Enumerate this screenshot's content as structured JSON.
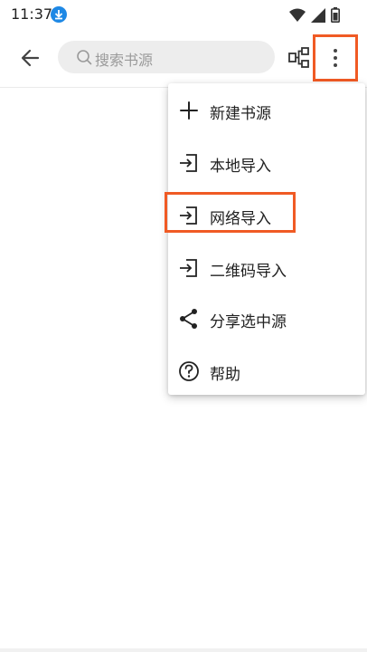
{
  "status_bar": {
    "time": "11:37",
    "icons": [
      "download-icon",
      "wifi-icon",
      "signal-icon",
      "battery-icon"
    ]
  },
  "toolbar": {
    "back_icon": "arrow-left-icon",
    "search_placeholder": "搜索书源",
    "group_icon": "group-icon",
    "more_icon": "more-vertical-icon"
  },
  "menu": {
    "items": [
      {
        "label": "新建书源",
        "icon": "plus-icon"
      },
      {
        "label": "本地导入",
        "icon": "import-icon"
      },
      {
        "label": "网络导入",
        "icon": "import-icon"
      },
      {
        "label": "二维码导入",
        "icon": "import-icon"
      },
      {
        "label": "分享选中源",
        "icon": "share-icon"
      },
      {
        "label": "帮助",
        "icon": "help-icon"
      }
    ]
  },
  "colors": {
    "highlight": "#f05a24",
    "accent_download": "#1e88e5",
    "search_bg": "#ededed"
  }
}
